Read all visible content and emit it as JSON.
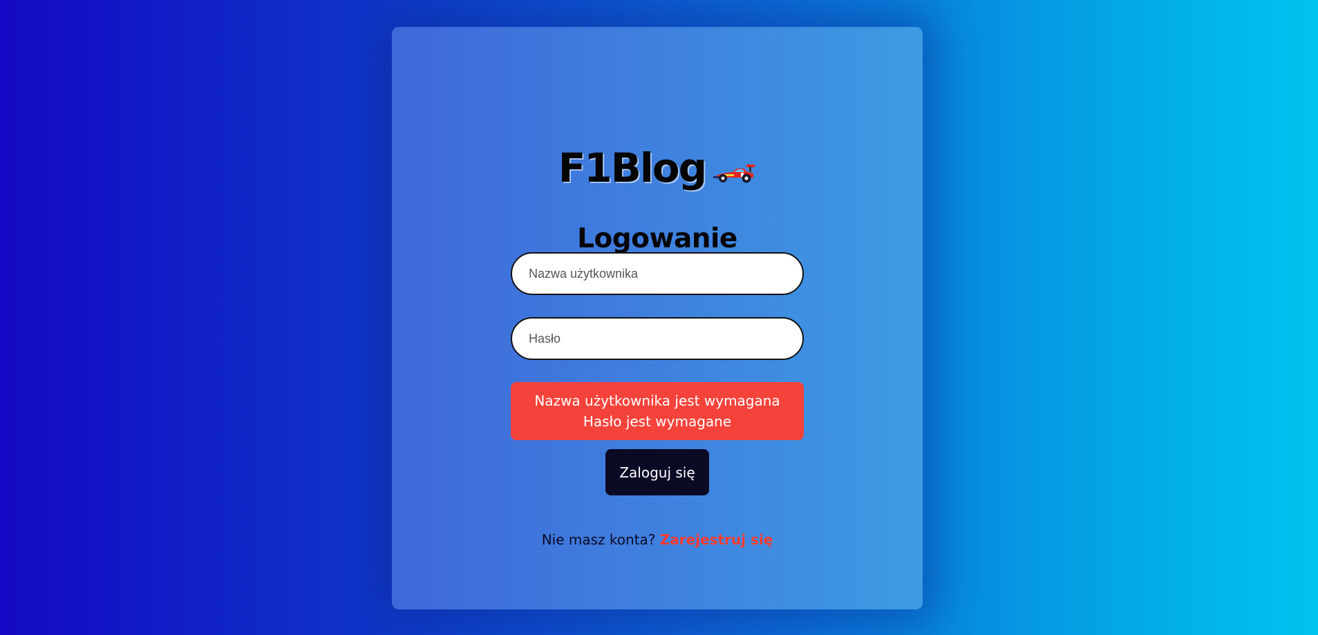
{
  "app": {
    "brand": "F1Blog",
    "brand_icon": "race-car-icon"
  },
  "login": {
    "heading": "Logowanie",
    "username": {
      "placeholder": "Nazwa użytkownika",
      "value": ""
    },
    "password": {
      "placeholder": "Hasło",
      "value": ""
    },
    "errors": [
      "Nazwa użytkownika jest wymagana",
      "Hasło jest wymagane"
    ],
    "submit_label": "Zaloguj się",
    "signup_prompt": "Nie masz konta?",
    "signup_link": "Zarejestruj się"
  },
  "colors": {
    "error_background": "#f4433b",
    "button_background": "#0b0a25",
    "link_accent": "#ff3b2f"
  }
}
